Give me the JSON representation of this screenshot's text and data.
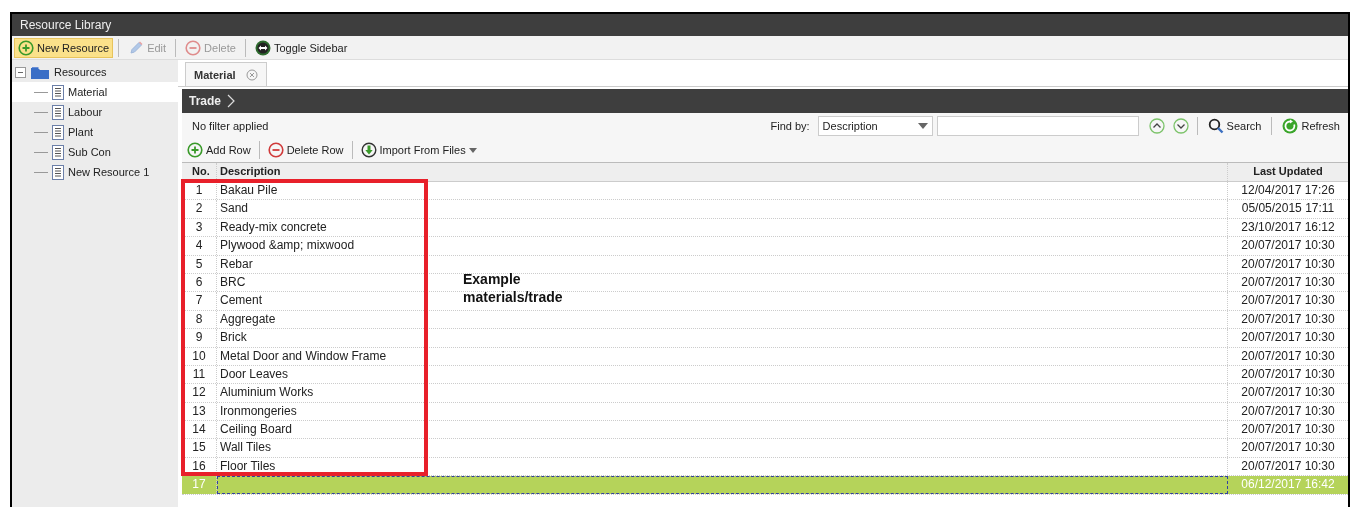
{
  "window": {
    "title": "Resource Library"
  },
  "toolbar": [
    {
      "kind": "add",
      "label": "New Resource",
      "disabled": false,
      "highlighted": true
    },
    {
      "kind": "edit",
      "label": "Edit",
      "disabled": true,
      "highlighted": false
    },
    {
      "kind": "delete",
      "label": "Delete",
      "disabled": true,
      "highlighted": false
    },
    {
      "kind": "toggle",
      "label": "Toggle Sidebar",
      "disabled": false,
      "highlighted": false
    }
  ],
  "sidebar": {
    "root": {
      "label": "Resources",
      "expanded": true,
      "children": [
        {
          "label": "Material",
          "selected": true
        },
        {
          "label": "Labour",
          "selected": false
        },
        {
          "label": "Plant",
          "selected": false
        },
        {
          "label": "Sub Con",
          "selected": false
        },
        {
          "label": "New Resource 1",
          "selected": false
        }
      ]
    }
  },
  "tabs": [
    {
      "label": "Material",
      "selected": true
    }
  ],
  "breadcrumb": "Trade",
  "filter_status": "No filter applied",
  "find": {
    "label": "Find by:",
    "field": "Description",
    "search": "Search",
    "refresh": "Refresh"
  },
  "grid_toolbar": [
    {
      "kind": "add",
      "label": "Add Row"
    },
    {
      "kind": "delete",
      "label": "Delete Row"
    },
    {
      "kind": "import",
      "label": "Import From Files"
    }
  ],
  "table": {
    "columns": [
      "No.",
      "Description",
      "Last Updated"
    ],
    "rows": [
      {
        "no": "1",
        "description": "Bakau Pile",
        "last_updated": "12/04/2017 17:26",
        "selected": false
      },
      {
        "no": "2",
        "description": "Sand",
        "last_updated": "05/05/2015 17:11",
        "selected": false
      },
      {
        "no": "3",
        "description": "Ready-mix concrete",
        "last_updated": "23/10/2017 16:12",
        "selected": false
      },
      {
        "no": "4",
        "description": "Plywood &amp; mixwood",
        "last_updated": "20/07/2017 10:30",
        "selected": false
      },
      {
        "no": "5",
        "description": "Rebar",
        "last_updated": "20/07/2017 10:30",
        "selected": false
      },
      {
        "no": "6",
        "description": "BRC",
        "last_updated": "20/07/2017 10:30",
        "selected": false
      },
      {
        "no": "7",
        "description": "Cement",
        "last_updated": "20/07/2017 10:30",
        "selected": false
      },
      {
        "no": "8",
        "description": "Aggregate",
        "last_updated": "20/07/2017 10:30",
        "selected": false
      },
      {
        "no": "9",
        "description": "Brick",
        "last_updated": "20/07/2017 10:30",
        "selected": false
      },
      {
        "no": "10",
        "description": "Metal Door and Window Frame",
        "last_updated": "20/07/2017 10:30",
        "selected": false
      },
      {
        "no": "11",
        "description": "Door Leaves",
        "last_updated": "20/07/2017 10:30",
        "selected": false
      },
      {
        "no": "12",
        "description": "Aluminium Works",
        "last_updated": "20/07/2017 10:30",
        "selected": false
      },
      {
        "no": "13",
        "description": "Ironmongeries",
        "last_updated": "20/07/2017 10:30",
        "selected": false
      },
      {
        "no": "14",
        "description": "Ceiling Board",
        "last_updated": "20/07/2017 10:30",
        "selected": false
      },
      {
        "no": "15",
        "description": "Wall Tiles",
        "last_updated": "20/07/2017 10:30",
        "selected": false
      },
      {
        "no": "16",
        "description": "Floor Tiles",
        "last_updated": "20/07/2017 10:30",
        "selected": false
      },
      {
        "no": "17",
        "description": "",
        "last_updated": "06/12/2017 16:42",
        "selected": true
      }
    ]
  },
  "annotation": {
    "lines": [
      "Example",
      "materials/trade"
    ]
  }
}
